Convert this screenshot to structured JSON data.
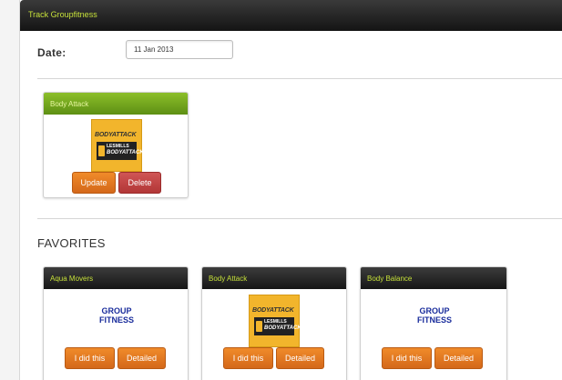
{
  "header": {
    "title": "Track Groupfitness"
  },
  "date": {
    "label": "Date:",
    "value": "11 Jan 2013"
  },
  "tracked": {
    "title": "Body Attack",
    "image": {
      "top_text": "BODYATTACK",
      "line1": "LESMILLS",
      "line2": "BODYATTACK"
    },
    "update_label": "Update",
    "delete_label": "Delete"
  },
  "favorites": {
    "heading": "FAVORITES",
    "items": [
      {
        "title": "Aqua Movers",
        "logo_line1": "GROUP",
        "logo_line2": "FITNESS",
        "did_label": "I did this",
        "detail_label": "Detailed"
      },
      {
        "title": "Body Attack",
        "image": {
          "top_text": "BODYATTACK",
          "line1": "LESMILLS",
          "line2": "BODYATTACK"
        },
        "did_label": "I did this",
        "detail_label": "Detailed"
      },
      {
        "title": "Body Balance",
        "logo_line1": "GROUP",
        "logo_line2": "FITNESS",
        "did_label": "I did this",
        "detail_label": "Detailed"
      }
    ]
  },
  "colors": {
    "accent_green": "#6fa41c",
    "header_text": "#c6e03a",
    "button_orange": "#e07a22",
    "button_red": "#c04545",
    "logo_blue": "#1a2d9c"
  }
}
